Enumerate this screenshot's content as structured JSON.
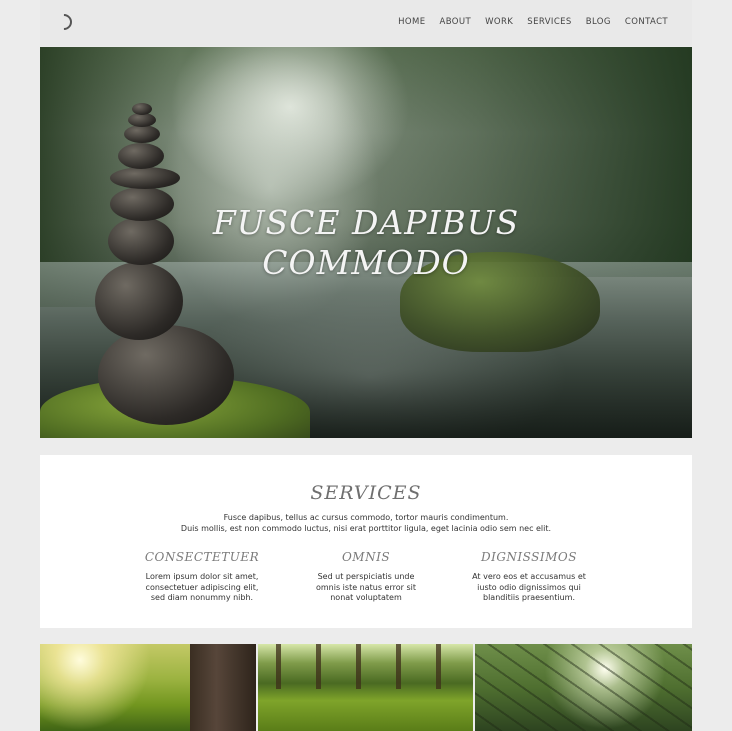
{
  "header": {
    "logo_icon": "circle-arc-logo-icon",
    "nav": [
      "HOME",
      "ABOUT",
      "WORK",
      "SERVICES",
      "BLOG",
      "CONTACT"
    ]
  },
  "hero": {
    "title_line1": "FUSCE DAPIBUS",
    "title_line2": "COMMODO"
  },
  "services": {
    "title": "SERVICES",
    "intro_line1": "Fusce dapibus, tellus ac cursus commodo, tortor mauris condimentum.",
    "intro_line2": "Duis mollis, est non commodo luctus, nisi erat porttitor ligula, eget lacinia odio sem nec elit.",
    "columns": [
      {
        "title": "CONSECTETUER",
        "line1": "Lorem ipsum dolor sit amet,",
        "line2": "consectetuer adipiscing elit,",
        "line3": "sed diam nonummy nibh."
      },
      {
        "title": "OMNIS",
        "line1": "Sed ut perspiciatis unde",
        "line2": "omnis iste natus error sit",
        "line3": "nonat voluptatem"
      },
      {
        "title": "DIGNISSIMOS",
        "line1": "At vero eos et accusamus et",
        "line2": "iusto odio dignissimos qui",
        "line3": "blanditiis praesentium."
      }
    ]
  }
}
